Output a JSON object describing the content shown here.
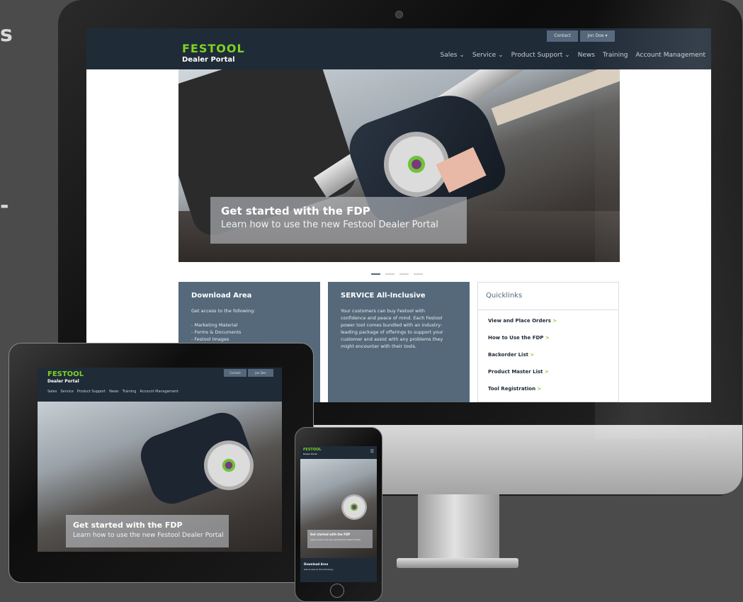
{
  "colors": {
    "brand_green": "#7ed321",
    "header_navy": "#202b38",
    "panel_slate": "#55697a",
    "backdrop": "#4b4b4b"
  },
  "edge_text": [
    "s",
    "-"
  ],
  "site": {
    "logo": "FESTOOL",
    "logo_sub": "Dealer Portal",
    "top_buttons": {
      "contact": "Contact",
      "user": "Jon Doe"
    },
    "nav": [
      {
        "label": "Sales",
        "dropdown": true
      },
      {
        "label": "Service",
        "dropdown": true
      },
      {
        "label": "Product Support",
        "dropdown": true
      },
      {
        "label": "News",
        "dropdown": false
      },
      {
        "label": "Training",
        "dropdown": false
      },
      {
        "label": "Account Management",
        "dropdown": false
      }
    ],
    "hero": {
      "title": "Get started with the FDP",
      "subtitle": "Learn how to use the new Festool Dealer Portal"
    },
    "slider_active_index": 0,
    "slider_count": 4,
    "download": {
      "title": "Download Area",
      "body": "Get access to the following:\n\n- Marketing Material\n- Forms & Documents\n- Festool Images"
    },
    "service": {
      "title": "SERVICE All-Inclusive",
      "body": "Your customers can buy Festool with\nconfidence and peace of mind. Each Festool\npower tool comes bundled with an industry-\nleading package of offerings to support your\ncustomer and assist with any problems they\nmight encounter with their tools."
    },
    "quicklinks": {
      "title": "Quicklinks",
      "items": [
        "View and Place Orders",
        "How to Use the FDP",
        "Backorder List",
        "Product Master List",
        "Tool Registration"
      ]
    }
  },
  "mobile": {
    "panel_title": "Download Area",
    "panel_text": "Get access to the following:"
  }
}
